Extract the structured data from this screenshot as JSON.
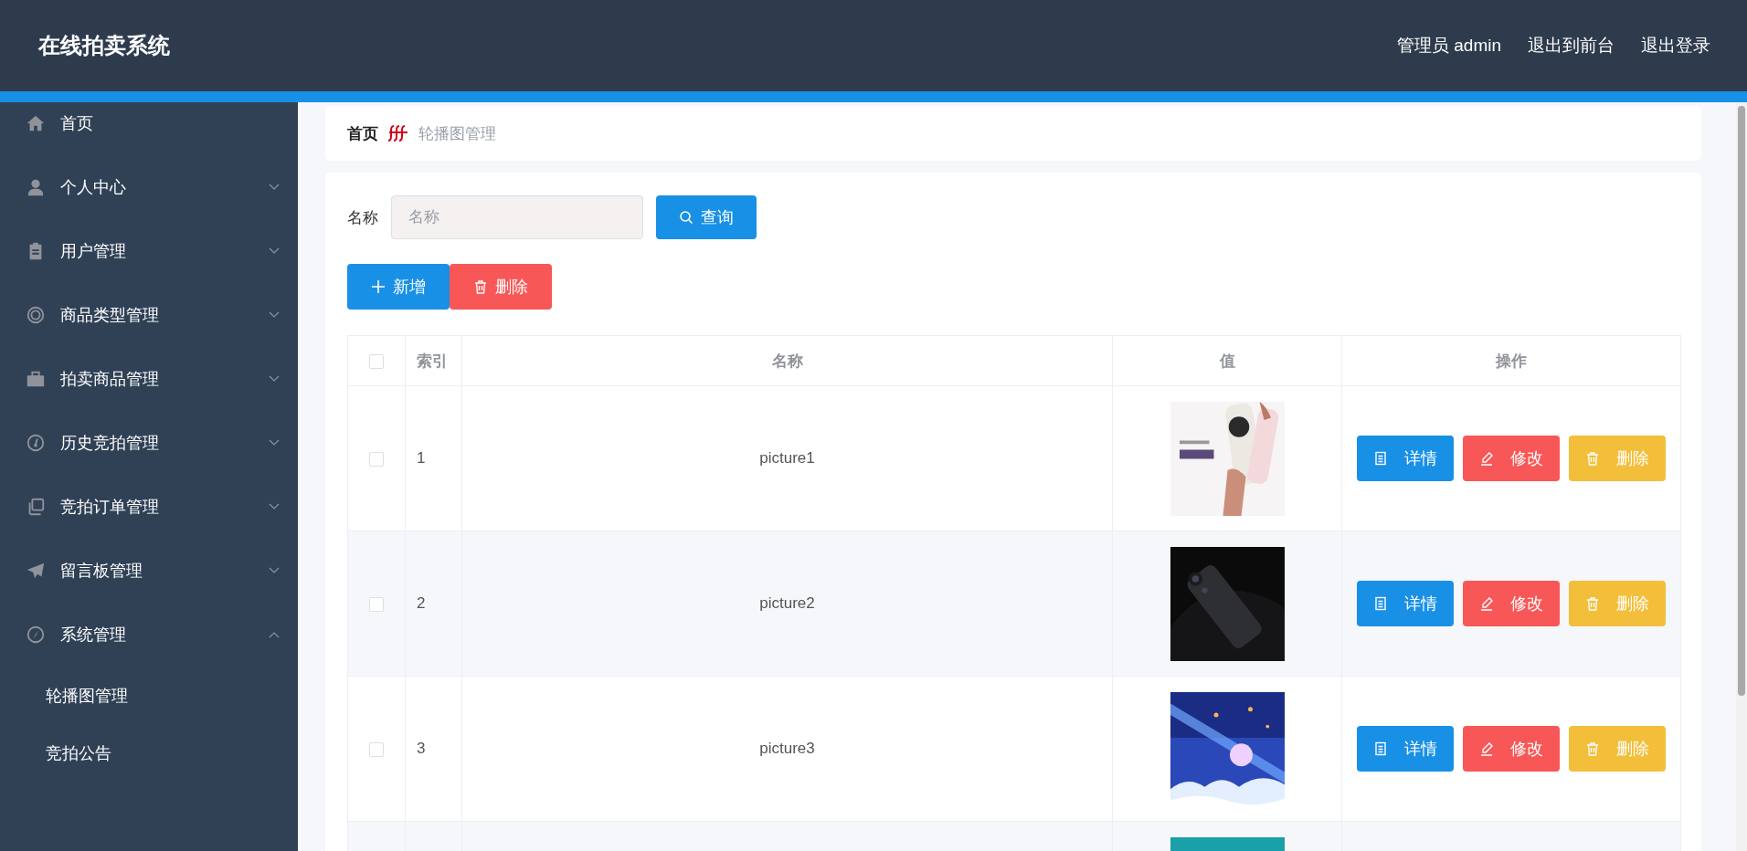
{
  "header": {
    "title": "在线拍卖系统",
    "links": [
      "管理员 admin",
      "退出到前台",
      "退出登录"
    ]
  },
  "sidebar": {
    "items": [
      {
        "label": "首页"
      },
      {
        "label": "个人中心",
        "expanded": false
      },
      {
        "label": "用户管理",
        "expanded": false
      },
      {
        "label": "商品类型管理",
        "expanded": false
      },
      {
        "label": "拍卖商品管理",
        "expanded": false
      },
      {
        "label": "历史竞拍管理",
        "expanded": false
      },
      {
        "label": "竞拍订单管理",
        "expanded": false
      },
      {
        "label": "留言板管理",
        "expanded": false
      },
      {
        "label": "系统管理",
        "expanded": true,
        "children": [
          {
            "label": "轮播图管理"
          },
          {
            "label": "竞拍公告"
          }
        ]
      }
    ]
  },
  "breadcrumb": {
    "home": "首页",
    "current": "轮播图管理"
  },
  "search": {
    "label": "名称",
    "placeholder": "名称",
    "button": "查询"
  },
  "toolbar": [
    {
      "label": "新增",
      "kind": "add"
    },
    {
      "label": "删除",
      "kind": "delete"
    }
  ],
  "table": {
    "all_checked": false,
    "columns": [
      "索引",
      "名称",
      "值",
      "操作"
    ],
    "rows": [
      {
        "checked": false,
        "index": "1",
        "name": "picture1",
        "value": {
          "kind": "picture"
        },
        "actions": [
          {
            "label": "详情",
            "kind": "detail"
          },
          {
            "label": "修改",
            "kind": "edit"
          },
          {
            "label": "删除",
            "kind": "delete"
          }
        ]
      },
      {
        "checked": false,
        "index": "2",
        "name": "picture2",
        "value": {
          "kind": "picture"
        },
        "actions": [
          {
            "label": "详情",
            "kind": "detail"
          },
          {
            "label": "修改",
            "kind": "edit"
          },
          {
            "label": "删除",
            "kind": "delete"
          }
        ]
      },
      {
        "checked": false,
        "index": "3",
        "name": "picture3",
        "value": {
          "kind": "picture"
        },
        "actions": [
          {
            "label": "详情",
            "kind": "detail"
          },
          {
            "label": "修改",
            "kind": "edit"
          },
          {
            "label": "删除",
            "kind": "delete"
          }
        ]
      },
      {
        "value": {
          "kind": "picture"
        }
      }
    ]
  }
}
